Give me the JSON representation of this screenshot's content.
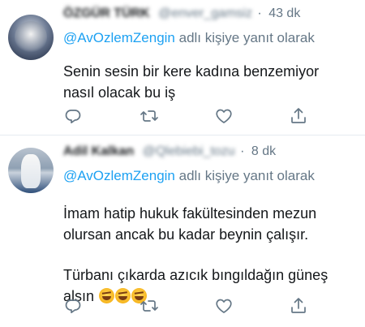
{
  "tweets": [
    {
      "author_name": "ÖZGÜR TÜRK",
      "handle": "@enver_gamsiz",
      "dot": "·",
      "time": "43 dk",
      "reply_mention": "@AvOzlemZengin",
      "reply_suffix": " adlı kişiye yanıt olarak",
      "text_lines": [
        "Senin sesin bir kere kadına benzemiyor",
        "nasıl olacak bu iş"
      ],
      "avatar_icon": "avatar-profile-icon"
    },
    {
      "author_name": "Adil Kalkan",
      "handle": "@Qlebiebi_tozu",
      "dot": "·",
      "time": "8 dk",
      "reply_mention": "@AvOzlemZengin",
      "reply_suffix": " adlı kişiye yanıt olarak",
      "text_lines": [
        "İmam hatip hukuk fakültesinden mezun",
        "olursan ancak bu kadar beynin çalışır.",
        "Türbanı çıkarda azıcık bıngıldağın güneş",
        "alsın"
      ],
      "emojis": [
        "🤣",
        "🤣",
        "🤣"
      ],
      "avatar_icon": "avatar-snowman-icon"
    }
  ],
  "actions": [
    "reply-icon",
    "retweet-icon",
    "like-icon",
    "share-icon"
  ],
  "colors": {
    "mention": "#1da1f2",
    "secondary_text": "#657786",
    "icon": "#657786",
    "divider": "#e6ecf0"
  }
}
